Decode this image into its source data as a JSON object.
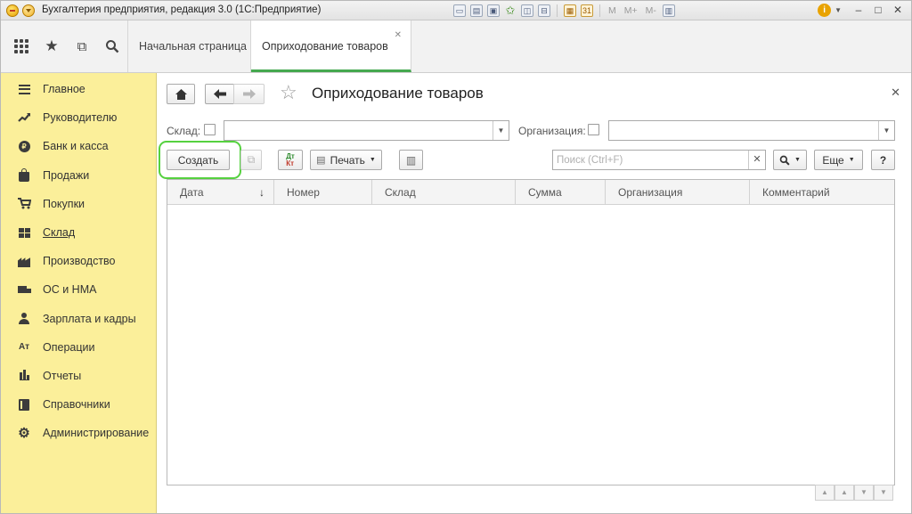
{
  "window": {
    "title": "Бухгалтерия предприятия, редакция 3.0  (1С:Предприятие)",
    "toolbar_memory": [
      "M",
      "M+",
      "M-"
    ]
  },
  "tabs": [
    {
      "label": "Начальная страница",
      "active": false
    },
    {
      "label": "Оприходование товаров",
      "active": true
    }
  ],
  "sidebar": {
    "items": [
      {
        "label": "Главное",
        "icon": "lines-icon"
      },
      {
        "label": "Руководителю",
        "icon": "trend-icon"
      },
      {
        "label": "Банк и касса",
        "icon": "coin-icon"
      },
      {
        "label": "Продажи",
        "icon": "bag-icon"
      },
      {
        "label": "Покупки",
        "icon": "cart-icon"
      },
      {
        "label": "Склад",
        "icon": "warehouse-icon",
        "current": true
      },
      {
        "label": "Производство",
        "icon": "factory-icon"
      },
      {
        "label": "ОС и НМА",
        "icon": "truck-icon"
      },
      {
        "label": "Зарплата и кадры",
        "icon": "user-icon"
      },
      {
        "label": "Операции",
        "icon": "operations-icon"
      },
      {
        "label": "Отчеты",
        "icon": "bar-chart-icon"
      },
      {
        "label": "Справочники",
        "icon": "book-icon"
      },
      {
        "label": "Администрирование",
        "icon": "gear-icon"
      }
    ]
  },
  "form": {
    "title": "Оприходование товаров",
    "filters": {
      "warehouse_label": "Склад:",
      "warehouse_value": "",
      "organization_label": "Организация:",
      "organization_value": ""
    },
    "toolbar": {
      "create_label": "Создать",
      "print_label": "Печать",
      "search_placeholder": "Поиск (Ctrl+F)",
      "more_label": "Еще",
      "help_label": "?"
    },
    "table": {
      "columns": [
        "Дата",
        "Номер",
        "Склад",
        "Сумма",
        "Организация",
        "Комментарий"
      ],
      "sort_column": "Дата",
      "sort_glyph": "↓",
      "rows": []
    }
  },
  "colors": {
    "sidebar_bg": "#fbef9a",
    "active_tab_accent": "#45a84f",
    "highlight": "#55d13f"
  }
}
